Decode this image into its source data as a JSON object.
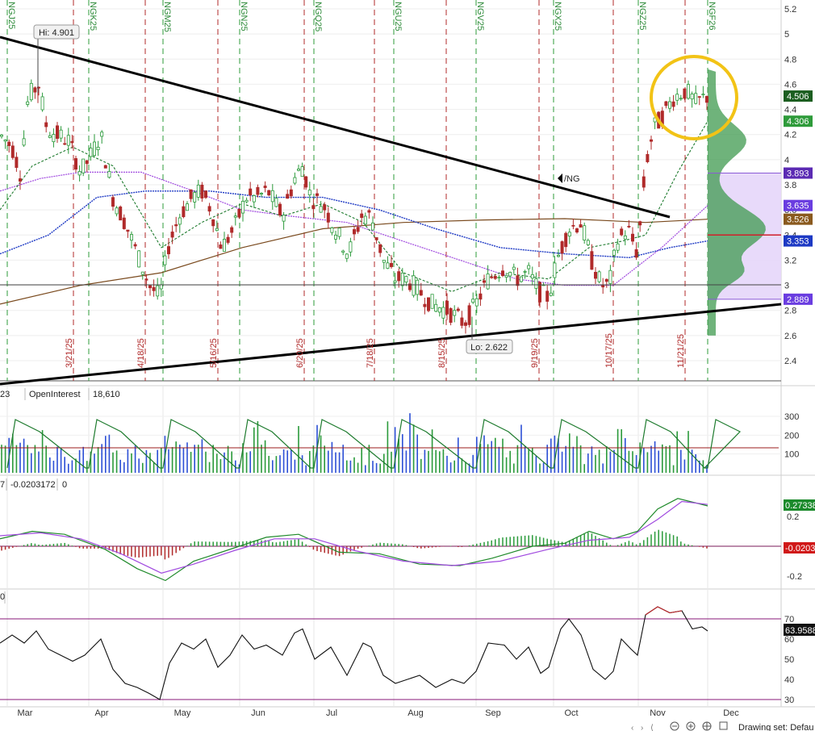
{
  "chart_data": {
    "type": "candlestick",
    "price_axis": {
      "ticks": [
        "5.2",
        "5",
        "4.8",
        "4.6",
        "4.4",
        "4.2",
        "4",
        "3.8",
        "3.6",
        "3.4",
        "3.2",
        "3",
        "2.8",
        "2.6",
        "2.4"
      ],
      "ylim": [
        2.2,
        5.25
      ]
    },
    "time_axis": {
      "months": [
        "Mar",
        "Apr",
        "May",
        "Jun",
        "Jul",
        "Aug",
        "Sep",
        "Oct",
        "Nov",
        "Dec"
      ],
      "expiration_dates": [
        "3/21/25",
        "4/18/25",
        "5/16/25",
        "6/20/25",
        "7/18/25",
        "8/15/25",
        "9/19/25",
        "10/17/25",
        "11/21/25"
      ],
      "contract_rolls": [
        "NGJ25",
        "NGK25",
        "NGM25",
        "NGN25",
        "NGQ25",
        "NGU25",
        "NGV25",
        "NGX25",
        "NGZ25",
        "NGF26"
      ]
    },
    "annotations": {
      "high": "Hi: 4.901",
      "low": "Lo: 2.622",
      "symbol": "/NG"
    },
    "price_labels": [
      {
        "value": "4.506",
        "color": "#1b5e20"
      },
      {
        "value": "4.306",
        "color": "#2e9b3a"
      },
      {
        "value": "3.893",
        "color": "#5b2ab3"
      },
      {
        "value": "3.635",
        "color": "#6a3de0"
      },
      {
        "value": "3.526",
        "color": "#8a5a1e"
      },
      {
        "value": "3.353",
        "color": "#1d39c4"
      },
      {
        "value": "2.889",
        "color": "#6a3de0"
      }
    ],
    "volume_panel": {
      "left_fragment": "23",
      "legend": "OpenInterest",
      "value": "18,610",
      "ticks": [
        "300",
        "200",
        "100"
      ]
    },
    "macd_panel": {
      "left_fragment": "7",
      "value": "-0.0203172",
      "zero_label": "0",
      "ticks": [
        "0.2",
        "-0.2"
      ],
      "right_labels": [
        {
          "value": "0.27338",
          "color": "#1b8a2b"
        },
        {
          "value": "-0.0203",
          "color": "#d01818"
        }
      ]
    },
    "rsi_panel": {
      "left_fragment": "0",
      "ticks": [
        "70",
        "60",
        "50",
        "40",
        "30"
      ],
      "right_label": "63.9588"
    },
    "footer": {
      "drawing_set": "Drawing set: Defau"
    },
    "colors": {
      "up": "#2a9a3a",
      "down": "#b02a2a",
      "trendline": "#000000",
      "highlight_circle": "#f2c316",
      "volume_profile": "#3f9a4f",
      "value_area": "#c9a8ef"
    }
  }
}
